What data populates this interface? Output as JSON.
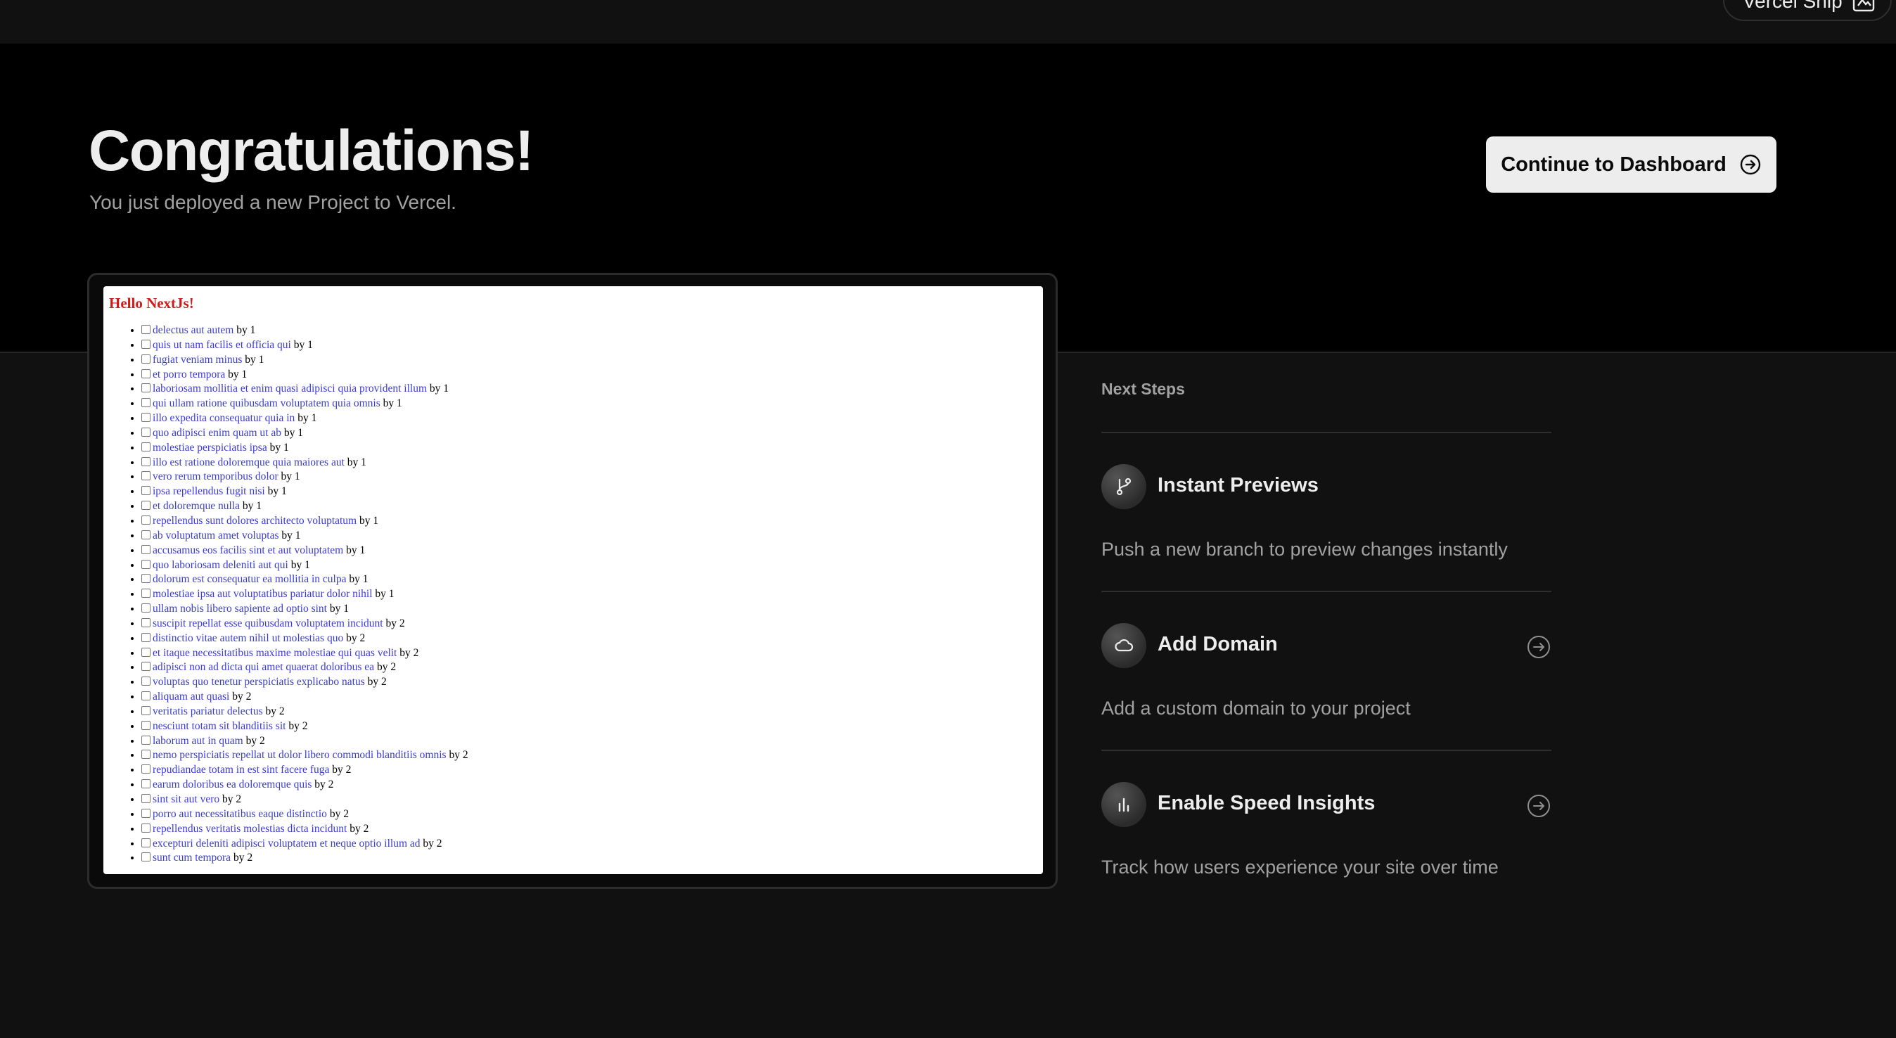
{
  "topbar": {
    "ship_label": "Vercel Ship",
    "ship_icon": "ship-icon"
  },
  "hero": {
    "title": "Congratulations!",
    "subtitle": "You just deployed a new Project to Vercel.",
    "dashboard_button": "Continue to Dashboard",
    "dashboard_button_icon": "arrow-right-circle-icon"
  },
  "preview": {
    "heading": "Hello NextJs!",
    "items": [
      {
        "text": "delectus aut autem",
        "by": "by 1"
      },
      {
        "text": "quis ut nam facilis et officia qui",
        "by": "by 1"
      },
      {
        "text": "fugiat veniam minus",
        "by": "by 1"
      },
      {
        "text": "et porro tempora",
        "by": "by 1"
      },
      {
        "text": "laboriosam mollitia et enim quasi adipisci quia provident illum",
        "by": "by 1"
      },
      {
        "text": "qui ullam ratione quibusdam voluptatem quia omnis",
        "by": "by 1"
      },
      {
        "text": "illo expedita consequatur quia in",
        "by": "by 1"
      },
      {
        "text": "quo adipisci enim quam ut ab",
        "by": "by 1"
      },
      {
        "text": "molestiae perspiciatis ipsa",
        "by": "by 1"
      },
      {
        "text": "illo est ratione doloremque quia maiores aut",
        "by": "by 1"
      },
      {
        "text": "vero rerum temporibus dolor",
        "by": "by 1"
      },
      {
        "text": "ipsa repellendus fugit nisi",
        "by": "by 1"
      },
      {
        "text": "et doloremque nulla",
        "by": "by 1"
      },
      {
        "text": "repellendus sunt dolores architecto voluptatum",
        "by": "by 1"
      },
      {
        "text": "ab voluptatum amet voluptas",
        "by": "by 1"
      },
      {
        "text": "accusamus eos facilis sint et aut voluptatem",
        "by": "by 1"
      },
      {
        "text": "quo laboriosam deleniti aut qui",
        "by": "by 1"
      },
      {
        "text": "dolorum est consequatur ea mollitia in culpa",
        "by": "by 1"
      },
      {
        "text": "molestiae ipsa aut voluptatibus pariatur dolor nihil",
        "by": "by 1"
      },
      {
        "text": "ullam nobis libero sapiente ad optio sint",
        "by": "by 1"
      },
      {
        "text": "suscipit repellat esse quibusdam voluptatem incidunt",
        "by": "by 2"
      },
      {
        "text": "distinctio vitae autem nihil ut molestias quo",
        "by": "by 2"
      },
      {
        "text": "et itaque necessitatibus maxime molestiae qui quas velit",
        "by": "by 2"
      },
      {
        "text": "adipisci non ad dicta qui amet quaerat doloribus ea",
        "by": "by 2"
      },
      {
        "text": "voluptas quo tenetur perspiciatis explicabo natus",
        "by": "by 2"
      },
      {
        "text": "aliquam aut quasi",
        "by": "by 2"
      },
      {
        "text": "veritatis pariatur delectus",
        "by": "by 2"
      },
      {
        "text": "nesciunt totam sit blanditiis sit",
        "by": "by 2"
      },
      {
        "text": "laborum aut in quam",
        "by": "by 2"
      },
      {
        "text": "nemo perspiciatis repellat ut dolor libero commodi blanditiis omnis",
        "by": "by 2"
      },
      {
        "text": "repudiandae totam in est sint facere fuga",
        "by": "by 2"
      },
      {
        "text": "earum doloribus ea doloremque quis",
        "by": "by 2"
      },
      {
        "text": "sint sit aut vero",
        "by": "by 2"
      },
      {
        "text": "porro aut necessitatibus eaque distinctio",
        "by": "by 2"
      },
      {
        "text": "repellendus veritatis molestias dicta incidunt",
        "by": "by 2"
      },
      {
        "text": "excepturi deleniti adipisci voluptatem et neque optio illum ad",
        "by": "by 2"
      },
      {
        "text": "sunt cum tempora",
        "by": "by 2"
      }
    ]
  },
  "next_steps": {
    "heading": "Next Steps",
    "cards": [
      {
        "title": "Instant Previews",
        "description": "Push a new branch to preview changes instantly",
        "icon": "git-branch-icon"
      },
      {
        "title": "Add Domain",
        "description": "Add a custom domain to your project",
        "icon": "cloud-icon",
        "action_icon": "arrow-right-circle-icon"
      },
      {
        "title": "Enable Speed Insights",
        "description": "Track how users experience your site over time",
        "icon": "bar-chart-icon",
        "action_icon": "arrow-right-circle-icon"
      }
    ]
  },
  "colors": {
    "page_bg": "#111111",
    "hero_bg": "#000000",
    "button_bg": "#ededed",
    "text_primary": "#ededed",
    "text_secondary": "#a1a1a1",
    "preview_heading": "#d11a1a",
    "preview_link": "#3b3bd6"
  }
}
